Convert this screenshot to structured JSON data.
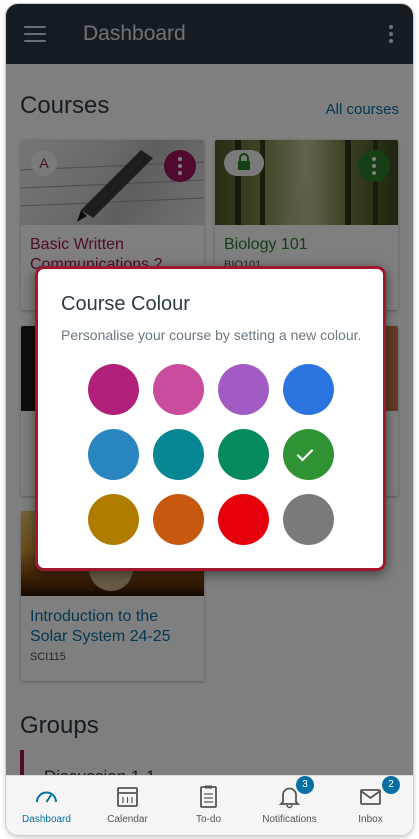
{
  "topbar": {
    "title": "Dashboard",
    "menu_icon": "hamburger-menu-icon",
    "more_icon": "vertical-dots-icon"
  },
  "courses": {
    "heading": "Courses",
    "all_courses_link": "All courses",
    "cards": [
      {
        "title_line1": "Basic Written",
        "title_line2": "Communications 2",
        "code": "",
        "badge": "A",
        "color": "#a0155b"
      },
      {
        "title_line1": "Biology 101",
        "title_line2": "",
        "code": "BIO101",
        "badge": "",
        "color": "#2a7f2a"
      },
      {
        "title_line1": "Introduction to the",
        "title_line2": "Solar System  24-25",
        "code": "SCI115",
        "badge": "",
        "color": "#0770a3"
      }
    ]
  },
  "groups": {
    "heading": "Groups",
    "items": [
      {
        "label": "Discussion 1-1"
      }
    ]
  },
  "dialog": {
    "title": "Course Colour",
    "subtitle": "Personalise your course by setting a new colour.",
    "swatches": [
      "#b0207a",
      "#c94c9e",
      "#a25bc2",
      "#2b74e0",
      "#2a86c0",
      "#078793",
      "#058a5b",
      "#2f9233",
      "#b07c00",
      "#c7580f",
      "#e5000c",
      "#7a7a7a"
    ],
    "selected_index": 7
  },
  "tabbar": {
    "tabs": [
      {
        "label": "Dashboard",
        "icon": "dashboard-icon",
        "badge": ""
      },
      {
        "label": "Calendar",
        "icon": "calendar-icon",
        "badge": ""
      },
      {
        "label": "To-do",
        "icon": "todo-icon",
        "badge": ""
      },
      {
        "label": "Notifications",
        "icon": "bell-icon",
        "badge": "3"
      },
      {
        "label": "Inbox",
        "icon": "inbox-icon",
        "badge": "2"
      }
    ]
  }
}
